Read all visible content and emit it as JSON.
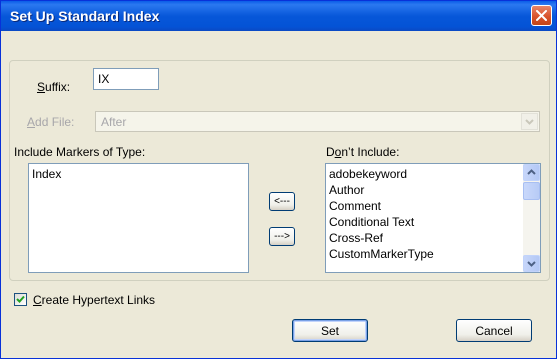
{
  "window": {
    "title": "Set Up Standard Index"
  },
  "suffix": {
    "label_accel": "S",
    "label_rest": "uffix:",
    "value": "IX"
  },
  "add_file": {
    "label_accel": "A",
    "label_rest": "dd File:",
    "selected": "After"
  },
  "include_markers": {
    "label": "Include Markers of Type:",
    "items": [
      "Index"
    ]
  },
  "dont_include": {
    "label_pre": "D",
    "label_accel": "o",
    "label_rest": "n’t Include:",
    "items": [
      "adobekeyword",
      "Author",
      "Comment",
      "Conditional Text",
      "Cross-Ref",
      "CustomMarkerType"
    ]
  },
  "move_left_button": {
    "label": "<---"
  },
  "move_right_button": {
    "label": "--->"
  },
  "hypertext": {
    "checked": true,
    "label_accel": "C",
    "label_rest": "reate Hypertext Links"
  },
  "buttons": {
    "set": "Set",
    "cancel": "Cancel"
  }
}
